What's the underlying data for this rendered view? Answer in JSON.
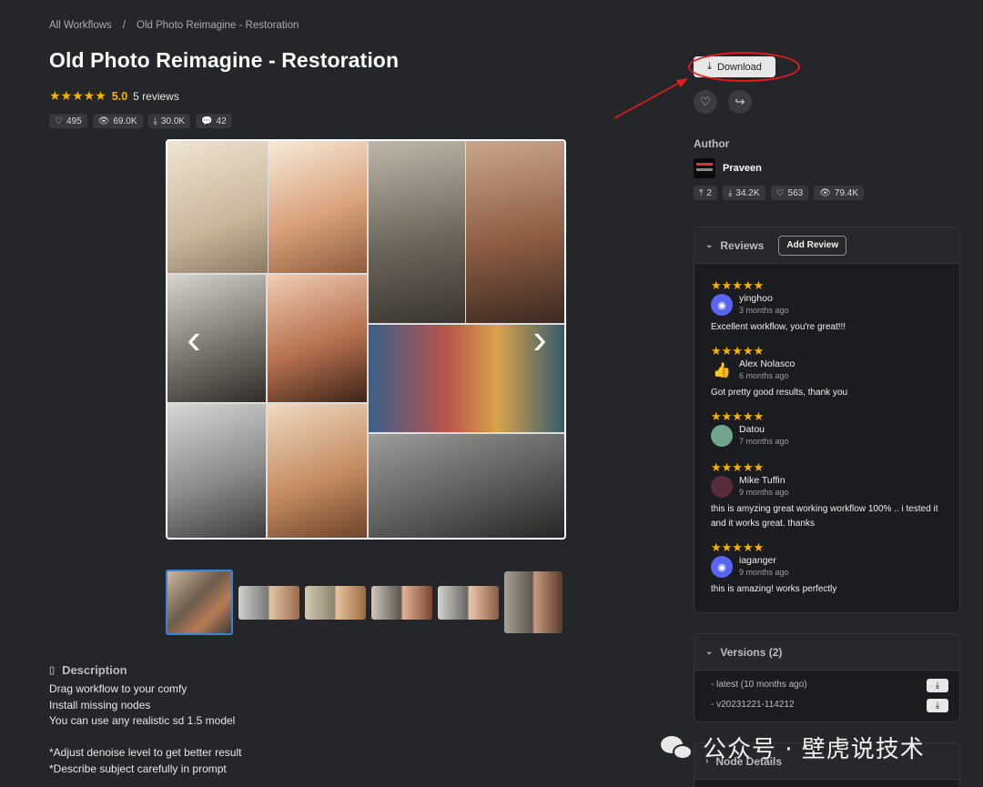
{
  "breadcrumb": {
    "root": "All Workflows",
    "sep": "/",
    "current": "Old Photo Reimagine - Restoration"
  },
  "title": "Old Photo Reimagine - Restoration",
  "rating": {
    "stars": "★★★★★",
    "score": "5.0",
    "reviews": "5 reviews"
  },
  "stats": {
    "likes": "495",
    "views": "69.0K",
    "downloads": "30.0K",
    "comments": "42"
  },
  "gallery": {
    "prev": "‹",
    "next": "›",
    "thumb_count": 6,
    "selected": 0
  },
  "description": {
    "heading": "Description",
    "lines": [
      "Drag workflow to your comfy",
      "Install missing nodes",
      "You can use any realistic sd 1.5 model",
      "",
      "*Adjust denoise level to get better result",
      "*Describe subject carefully in prompt"
    ]
  },
  "actions": {
    "download": "Download"
  },
  "author": {
    "heading": "Author",
    "name": "Praveen",
    "stats": {
      "uploads": "2",
      "downloads": "34.2K",
      "likes": "563",
      "views": "79.4K"
    }
  },
  "reviews": {
    "heading": "Reviews",
    "add": "Add Review",
    "items": [
      {
        "stars": "★★★★★",
        "user": "yinghoo",
        "time": "3 months ago",
        "text": "Excellent workflow, you're great!!!"
      },
      {
        "stars": "★★★★★",
        "user": "Alex Nolasco",
        "time": "6 months ago",
        "text": "Got pretty good results, thank you"
      },
      {
        "stars": "★★★★★",
        "user": "Datou",
        "time": "7 months ago",
        "text": ""
      },
      {
        "stars": "★★★★★",
        "user": "Mike Tuffin",
        "time": "9 months ago",
        "text": "this is amyzing great working workflow 100% .. i tested it and it works great. thanks"
      },
      {
        "stars": "★★★★★",
        "user": "iaganger",
        "time": "9 months ago",
        "text": "this is amazing! works perfectly"
      }
    ]
  },
  "versions": {
    "heading": "Versions (2)",
    "items": [
      "- latest (10 months ago)",
      "- v20231221-114212"
    ]
  },
  "node_details": {
    "heading": "Node Details"
  },
  "watermark": {
    "text": "公众号 · 壁虎说技术"
  },
  "colors": {
    "accent_star": "#f5b400",
    "annotation_red": "#e21b1b",
    "background": "#25262a"
  }
}
